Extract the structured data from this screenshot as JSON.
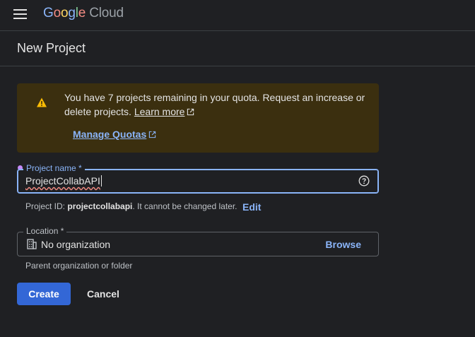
{
  "header": {
    "logo_google": [
      "G",
      "o",
      "o",
      "g",
      "l",
      "e"
    ],
    "logo_cloud": "Cloud",
    "menu_icon": "hamburger-menu-icon"
  },
  "page": {
    "title": "New Project"
  },
  "banner": {
    "text": "You have 7 projects remaining in your quota. Request an increase or delete projects.",
    "learn_more": "Learn more",
    "manage_quotas": "Manage Quotas",
    "icon": "warning-icon"
  },
  "project_name": {
    "label": "Project name *",
    "value": "ProjectCollabAPI",
    "help_icon": "help-circle-icon"
  },
  "project_id": {
    "prefix": "Project ID: ",
    "id": "projectcollabapi",
    "suffix": ". It cannot be changed later.",
    "edit_label": "Edit"
  },
  "location": {
    "label": "Location *",
    "value": "No organization",
    "browse_label": "Browse",
    "helper": "Parent organization or folder",
    "icon": "building-icon"
  },
  "actions": {
    "create_label": "Create",
    "cancel_label": "Cancel"
  },
  "colors": {
    "background": "#1f2023",
    "accent": "#8ab4f8",
    "primary_button": "#3367d6",
    "banner_bg": "#3b2f0f",
    "warning": "#fbbc04"
  }
}
